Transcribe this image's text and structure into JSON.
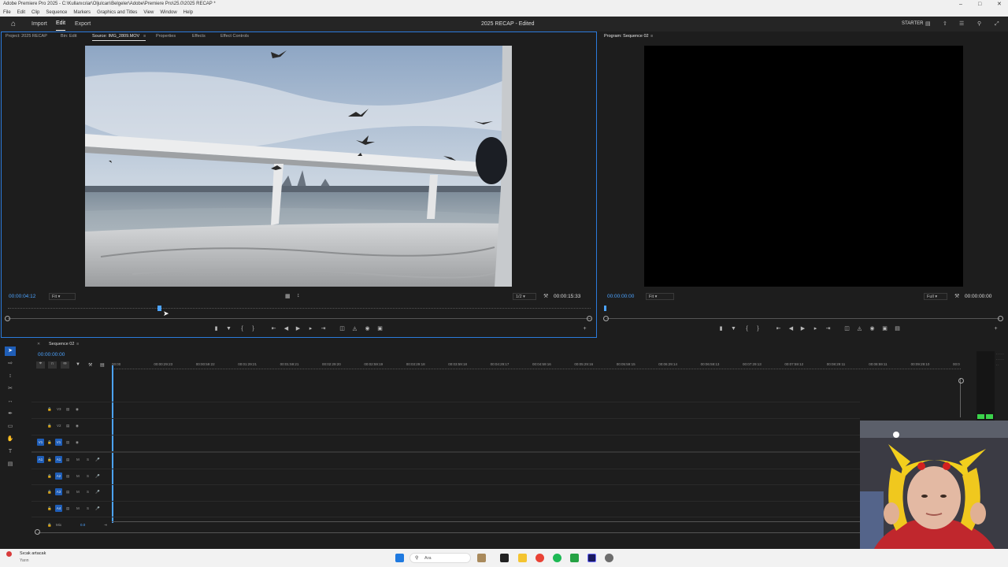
{
  "window": {
    "title": "Adobe Premiere Pro 2025 - C:\\Kullanıcılar\\Oljulcan\\Belgeler\\Adobe\\Premiere Pro\\25.0\\2025 RECAP *"
  },
  "menu": [
    "File",
    "Edit",
    "Clip",
    "Sequence",
    "Markers",
    "Graphics and Titles",
    "View",
    "Window",
    "Help"
  ],
  "workspace": {
    "home_icon": "home-icon",
    "tabs": [
      "Import",
      "Edit",
      "Export"
    ],
    "active_tab": "Edit",
    "project_title": "2025 RECAP - Edited",
    "mode": "STARTER"
  },
  "source_panel": {
    "tabs": [
      "Project: 2025 RECAP",
      "Bin: Edit",
      "Source: IMG_2809.MOV",
      "Properties",
      "Effects",
      "Effect Controls"
    ],
    "active_tab": "Source: IMG_2809.MOV",
    "timecode": "00:00:04:12",
    "zoom": "Fit",
    "resolution": "1/2",
    "duration": "00:00:15:33",
    "playhead_fraction": 0.26
  },
  "program_panel": {
    "title": "Program: Sequence 02",
    "timecode": "00:00:00:00",
    "zoom": "Fit",
    "resolution": "Full",
    "duration": "00:00:00:00"
  },
  "timeline": {
    "sequence": "Sequence 02",
    "timecode": "00:00:00:00",
    "ruler_ticks": [
      "00:00",
      "00:00:29:23",
      "00:00:59:22",
      "00:01:29:21",
      "00:01:59:21",
      "00:02:29:20",
      "00:02:59:19",
      "00:03:29:18",
      "00:03:59:18",
      "00:04:29:17",
      "00:04:59:16",
      "00:05:29:16",
      "00:05:59:15",
      "00:06:29:14",
      "00:06:59:13",
      "00:07:29:13",
      "00:07:59:12",
      "00:08:29:11",
      "00:08:59:11",
      "00:09:29:10",
      "00:0"
    ],
    "video_tracks": [
      "V3",
      "V2",
      "V1"
    ],
    "audio_tracks": [
      "A1",
      "A2",
      "A3",
      "A4"
    ],
    "mix_label": "Mix",
    "mix_value": "0.0",
    "source_patch_v": "V1",
    "source_patch_a": "A1"
  },
  "taskbar": {
    "notification_title": "Sıcak artacak",
    "notification_sub": "Yarın",
    "search_placeholder": "Ara"
  },
  "colors": {
    "accent": "#2b7bdc",
    "panel_bg": "#1d1d1d",
    "timecode_blue": "#4ca3ff",
    "track_blue": "#1f5eb8"
  }
}
